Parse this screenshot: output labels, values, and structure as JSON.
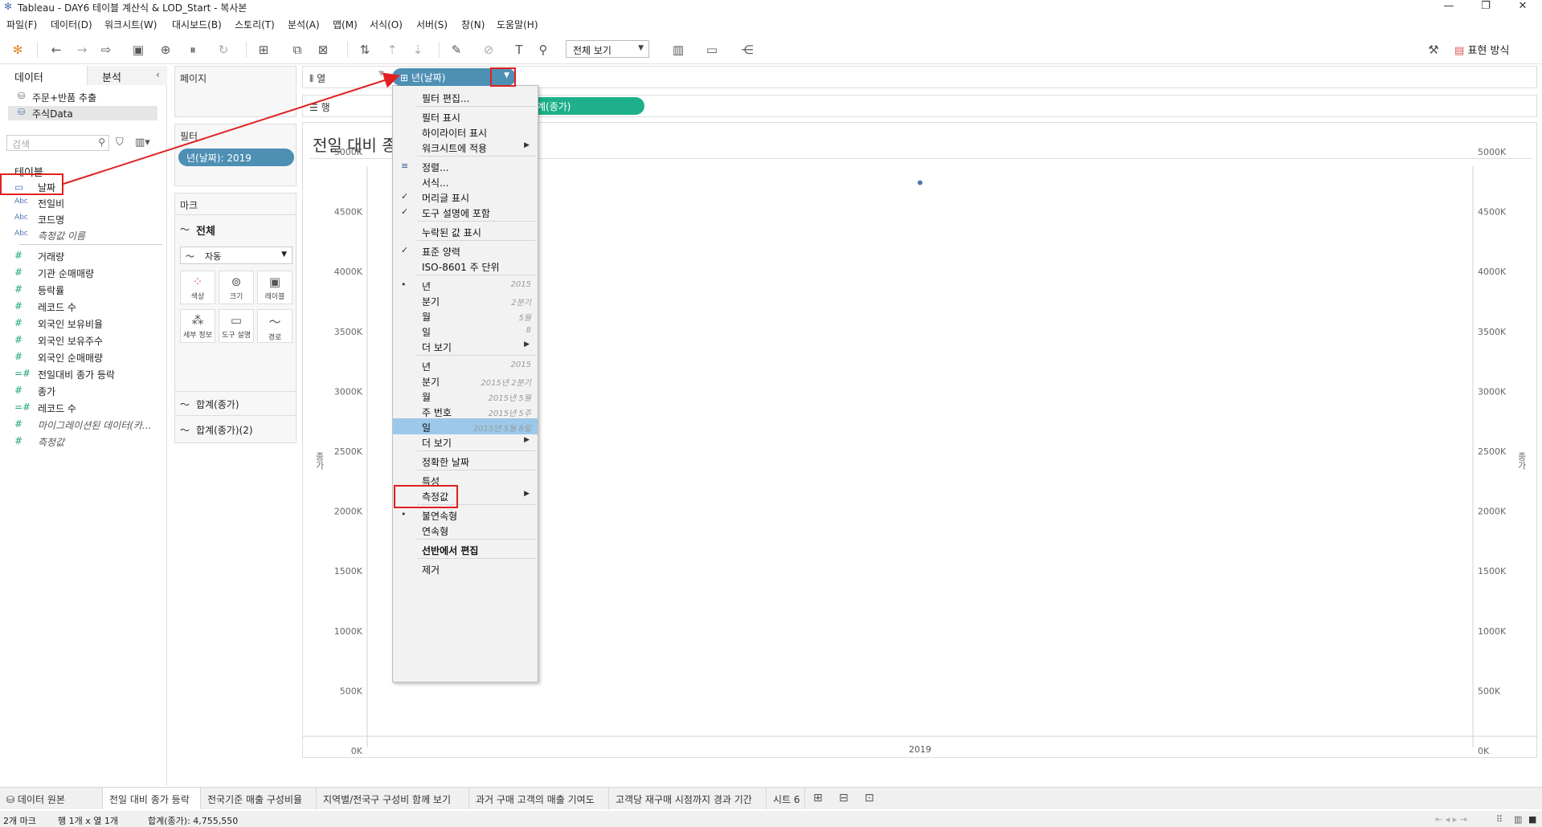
{
  "window": {
    "title": "Tableau - DAY6 테이블 계산식 & LOD_Start - 복사본",
    "controls": [
      "—",
      "❐",
      "✕"
    ]
  },
  "menubar": [
    "파일(F)",
    "데이터(D)",
    "워크시트(W)",
    "대시보드(B)",
    "스토리(T)",
    "분석(A)",
    "맵(M)",
    "서식(O)",
    "서버(S)",
    "창(N)",
    "도움말(H)"
  ],
  "toolbar": {
    "view_select": "전체 보기",
    "show_me": "표현 방식"
  },
  "datapane": {
    "tab_data": "데이터",
    "tab_analysis": "분석",
    "sources": [
      "주문+반품 추출",
      "주식Data"
    ],
    "search_placeholder": "검색",
    "section_label": "테이블",
    "dimensions": [
      {
        "icon": "date",
        "label": "날짜"
      },
      {
        "icon": "Abc",
        "label": "전일비"
      },
      {
        "icon": "Abc",
        "label": "코드명"
      },
      {
        "icon": "Abc",
        "label": "측정값 이름"
      }
    ],
    "measures": [
      {
        "icon": "#",
        "label": "거래량"
      },
      {
        "icon": "#",
        "label": "기관 순매매량"
      },
      {
        "icon": "#",
        "label": "등락률"
      },
      {
        "icon": "#",
        "label": "레코드 수"
      },
      {
        "icon": "#",
        "label": "외국인 보유비율"
      },
      {
        "icon": "#",
        "label": "외국인 보유주수"
      },
      {
        "icon": "#",
        "label": "외국인 순매매량"
      },
      {
        "icon": "=#",
        "label": "전일대비 종가 등락"
      },
      {
        "icon": "#",
        "label": "종가"
      },
      {
        "icon": "=#",
        "label": "레코드 수"
      },
      {
        "icon": "#",
        "label": "마이그레이션된 데이터(카..."
      },
      {
        "icon": "#",
        "label": "측정값"
      }
    ]
  },
  "cards": {
    "pages": "페이지",
    "filters": "필터",
    "filter_pill": "년(날짜): 2019",
    "marks": "마크",
    "marks_all": "전체",
    "mark_type": "자동",
    "mark_buttons": [
      "색상",
      "크기",
      "레이블",
      "세부 정보",
      "도구 설명",
      "경로"
    ],
    "mark_fields": [
      "합계(종가)",
      "합계(종가)(2)"
    ]
  },
  "shelves": {
    "columns_label": "열",
    "rows_label": "행",
    "columns_pill": "년(날짜)",
    "rows_pill": "계(종가)"
  },
  "view": {
    "sheet_title": "전일 대비 종",
    "axis_title_left": "종가",
    "axis_title_right": "종가",
    "x_label": "2019"
  },
  "chart_data": {
    "type": "scatter",
    "title": "전일 대비 종",
    "x": [
      "2019"
    ],
    "y": [
      4755550
    ],
    "ylabel": "종가",
    "ylim": [
      0,
      5000000
    ],
    "yticks": [
      "0K",
      "500K",
      "1000K",
      "1500K",
      "2000K",
      "2500K",
      "3000K",
      "3500K",
      "4000K",
      "4500K",
      "5000K"
    ],
    "point_color": "#4e79a7"
  },
  "context_menu": [
    {
      "label": "필터 편집...",
      "hint": "",
      "check": "",
      "sub": false,
      "bold": false,
      "sep_after": true
    },
    {
      "label": "필터 표시",
      "hint": "",
      "check": "",
      "sub": false,
      "bold": false,
      "sep_after": false
    },
    {
      "label": "하이라이터 표시",
      "hint": "",
      "check": "",
      "sub": false,
      "bold": false,
      "sep_after": false
    },
    {
      "label": "워크시트에 적용",
      "hint": "",
      "check": "",
      "sub": true,
      "bold": false,
      "sep_after": true
    },
    {
      "label": "정렬...",
      "hint": "",
      "check": "sort",
      "sub": false,
      "bold": false,
      "sep_after": false
    },
    {
      "label": "서식...",
      "hint": "",
      "check": "",
      "sub": false,
      "bold": false,
      "sep_after": false
    },
    {
      "label": "머리글 표시",
      "hint": "",
      "check": "✓",
      "sub": false,
      "bold": false,
      "sep_after": false
    },
    {
      "label": "도구 설명에 포함",
      "hint": "",
      "check": "✓",
      "sub": false,
      "bold": false,
      "sep_after": true
    },
    {
      "label": "누락된 값 표시",
      "hint": "",
      "check": "",
      "sub": false,
      "bold": false,
      "sep_after": true
    },
    {
      "label": "표준 양력",
      "hint": "",
      "check": "✓",
      "sub": false,
      "bold": false,
      "sep_after": false
    },
    {
      "label": "ISO-8601 주 단위",
      "hint": "",
      "check": "",
      "sub": false,
      "bold": false,
      "sep_after": true
    },
    {
      "label": "년",
      "hint": "2015",
      "check": "•",
      "sub": false,
      "bold": false,
      "sep_after": false
    },
    {
      "label": "분기",
      "hint": "2분기",
      "check": "",
      "sub": false,
      "bold": false,
      "sep_after": false
    },
    {
      "label": "월",
      "hint": "5월",
      "check": "",
      "sub": false,
      "bold": false,
      "sep_after": false
    },
    {
      "label": "일",
      "hint": "8",
      "check": "",
      "sub": false,
      "bold": false,
      "sep_after": false
    },
    {
      "label": "더 보기",
      "hint": "",
      "check": "",
      "sub": true,
      "bold": false,
      "sep_after": true
    },
    {
      "label": "년",
      "hint": "2015",
      "check": "",
      "sub": false,
      "bold": false,
      "sep_after": false
    },
    {
      "label": "분기",
      "hint": "2015년 2분기",
      "check": "",
      "sub": false,
      "bold": false,
      "sep_after": false
    },
    {
      "label": "월",
      "hint": "2015년 5월",
      "check": "",
      "sub": false,
      "bold": false,
      "sep_after": false
    },
    {
      "label": "주 번호",
      "hint": "2015년 5주",
      "check": "",
      "sub": false,
      "bold": false,
      "sep_after": false
    },
    {
      "label": "일",
      "hint": "2015년 5월 8일",
      "check": "",
      "sub": false,
      "bold": false,
      "sep_after": false,
      "highlight": true
    },
    {
      "label": "더 보기",
      "hint": "",
      "check": "",
      "sub": true,
      "bold": false,
      "sep_after": true
    },
    {
      "label": "정확한 날짜",
      "hint": "",
      "check": "",
      "sub": false,
      "bold": false,
      "sep_after": true
    },
    {
      "label": "특성",
      "hint": "",
      "check": "",
      "sub": false,
      "bold": false,
      "sep_after": false
    },
    {
      "label": "측정값",
      "hint": "",
      "check": "",
      "sub": true,
      "bold": false,
      "sep_after": true
    },
    {
      "label": "불연속형",
      "hint": "",
      "check": "•",
      "sub": false,
      "bold": false,
      "sep_after": false
    },
    {
      "label": "연속형",
      "hint": "",
      "check": "",
      "sub": false,
      "bold": false,
      "sep_after": true
    },
    {
      "label": "선반에서 편집",
      "hint": "",
      "check": "",
      "sub": false,
      "bold": true,
      "sep_after": true
    },
    {
      "label": "제거",
      "hint": "",
      "check": "",
      "sub": false,
      "bold": false,
      "sep_after": false
    }
  ],
  "sheet_tabs": [
    "데이터 원본",
    "전일 대비 종가 등락",
    "전국기준 매출 구성비율",
    "지역별/전국구 구성비 함께 보기",
    "과거 구매 고객의 매출 기여도",
    "고객당 재구매 시점까지 경과 기간",
    "시트 6"
  ],
  "status": {
    "marks": "2개 마크",
    "rows_cols": "행 1개 x 열 1개",
    "sum": "합계(종가): 4,755,550"
  },
  "colors": {
    "pill_blue": "#4e8fb4",
    "pill_green": "#1db08a",
    "menu_highlight": "#9cc8ea",
    "annotation_red": "#e02020"
  }
}
